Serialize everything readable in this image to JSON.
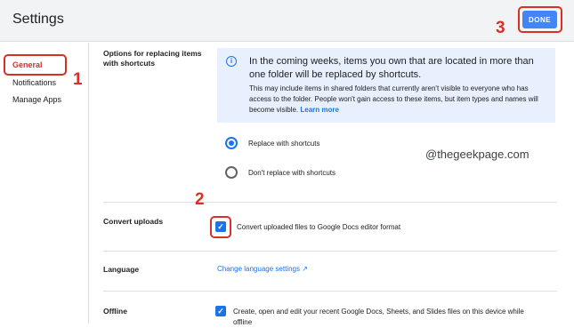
{
  "header": {
    "title": "Settings",
    "done_label": "DONE"
  },
  "annotations": {
    "step1": "1",
    "step2": "2",
    "step3": "3"
  },
  "sidebar": {
    "items": [
      {
        "label": "General",
        "active": true
      },
      {
        "label": "Notifications",
        "active": false
      },
      {
        "label": "Manage Apps",
        "active": false
      }
    ]
  },
  "sections": {
    "replace": {
      "label_line1": "Options for replacing items",
      "label_line2": "with shortcuts",
      "info_head": "In the coming weeks, items you own that are located in more than one folder will be replaced by shortcuts.",
      "info_body": "This may include items in shared folders that currently aren't visible to everyone who has access to the folder. People won't gain access to these items, but item types and names will become visible.",
      "info_link": "Learn more",
      "options": [
        {
          "label": "Replace with shortcuts",
          "selected": true
        },
        {
          "label": "Don't replace with shortcuts",
          "selected": false
        }
      ]
    },
    "convert": {
      "label": "Convert uploads",
      "checkbox_label": "Convert uploaded files to Google Docs editor format",
      "checked": true
    },
    "language": {
      "label": "Language",
      "link": "Change language settings"
    },
    "offline": {
      "label": "Offline",
      "checkbox_label": "Create, open and edit your recent Google Docs, Sheets, and Slides files on this device while",
      "checkbox_label2": "offline",
      "checked": true
    }
  },
  "watermark": "@thegeekpage.com",
  "colors": {
    "accent": "#1a73e8",
    "annotation": "#d93025",
    "done_button": "#4285f4",
    "info_bg": "#e8f0fe"
  }
}
